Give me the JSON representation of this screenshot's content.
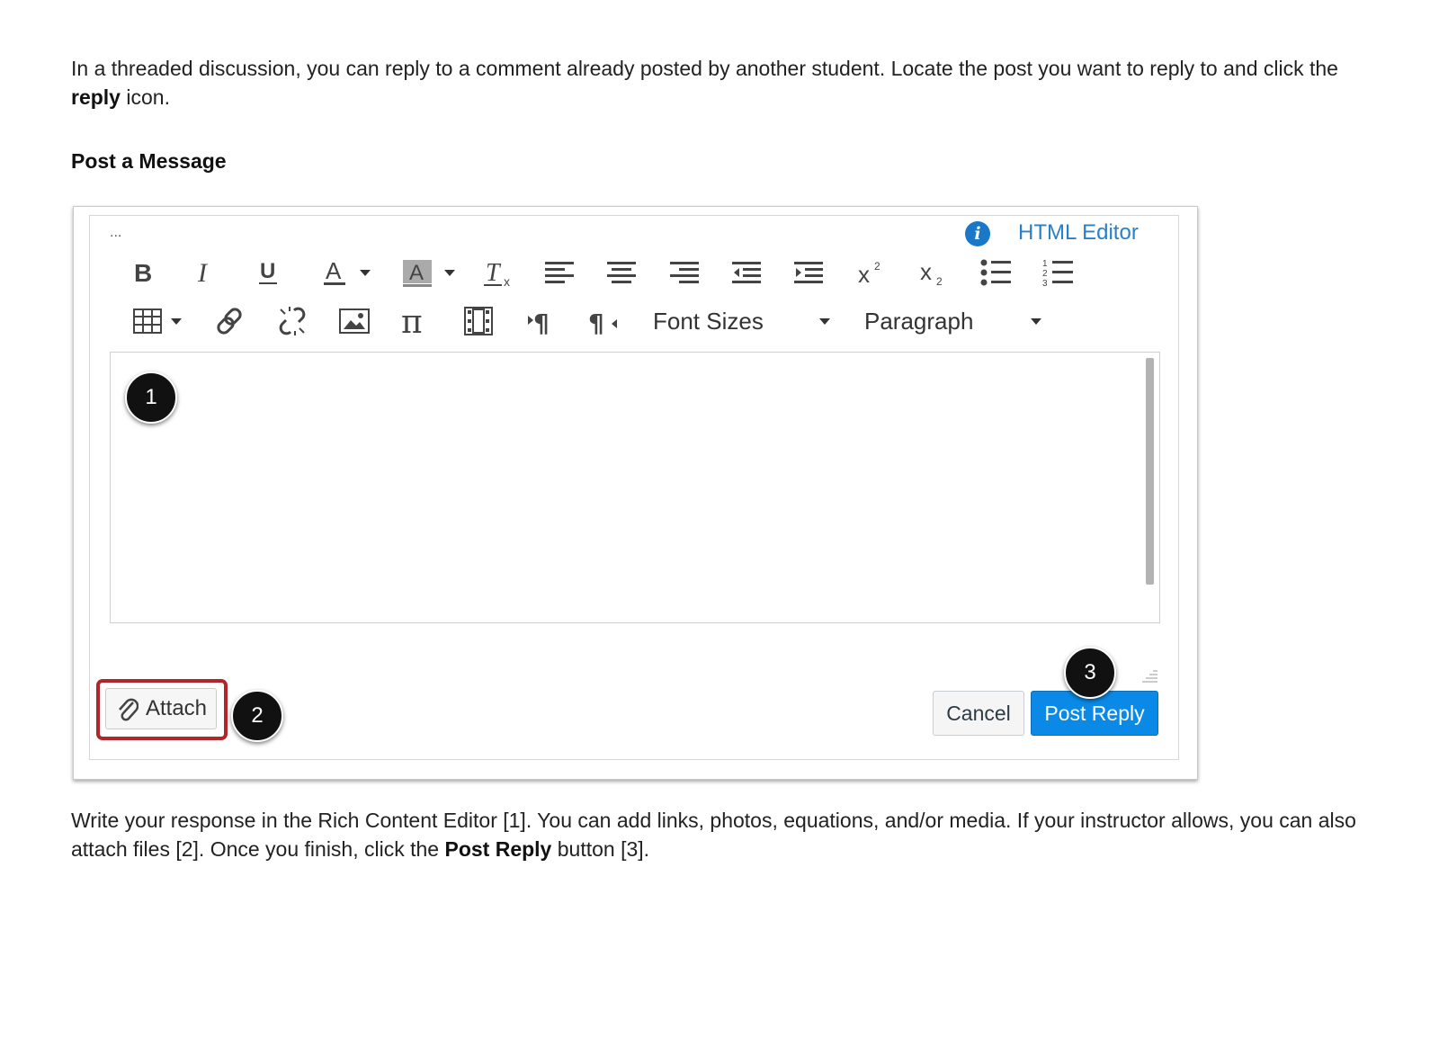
{
  "intro": {
    "text_before": "In a threaded discussion, you can reply to a comment already posted by another student. Locate the post you want to reply to and click the ",
    "bold": "reply",
    "text_after": " icon."
  },
  "heading": "Post a Message",
  "editor": {
    "more_dots": "...",
    "info_icon_glyph": "i",
    "html_editor_label": "HTML Editor",
    "toolbar_row1": [
      "bold-icon",
      "italic-icon",
      "underline-icon",
      "text-color-icon",
      "background-color-icon",
      "clear-formatting-icon",
      "align-left-icon",
      "align-center-icon",
      "align-right-icon",
      "outdent-icon",
      "indent-icon",
      "superscript-icon",
      "subscript-icon",
      "bullet-list-icon",
      "numbered-list-icon"
    ],
    "toolbar_row2": [
      "table-icon",
      "link-icon",
      "unlink-icon",
      "image-icon",
      "equation-icon",
      "media-icon",
      "ltr-icon",
      "rtl-icon"
    ],
    "font_sizes_label": "Font Sizes",
    "paragraph_label": "Paragraph",
    "attach_label": "Attach",
    "cancel_label": "Cancel",
    "post_reply_label": "Post Reply",
    "highlight_color": "#b1252b",
    "primary_color": "#0a8ae6"
  },
  "callouts": [
    "1",
    "2",
    "3"
  ],
  "outro": {
    "text_before": "Write your response in the Rich Content Editor [1]. You can add links, photos, equations, and/or media. If your instructor allows, you can also attach files [2]. Once you finish, click the ",
    "bold": "Post Reply",
    "text_after": " button [3]."
  }
}
